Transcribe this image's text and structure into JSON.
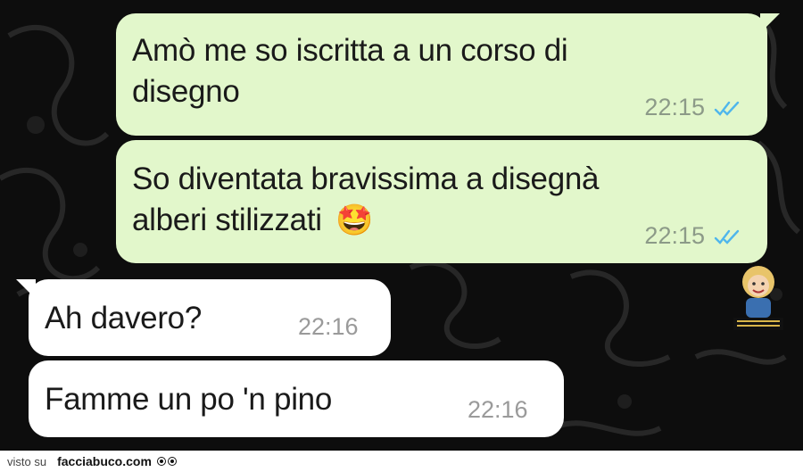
{
  "messages": [
    {
      "direction": "outgoing",
      "lines": [
        "Amò me so iscritta a un corso di",
        "disegno"
      ],
      "time": "22:15",
      "status_icon": "double-check-read-icon"
    },
    {
      "direction": "outgoing",
      "lines": [
        "So diventata bravissima a disegnà",
        "alberi stilizzati"
      ],
      "emoji": "🤩",
      "time": "22:15",
      "status_icon": "double-check-read-icon"
    },
    {
      "direction": "incoming",
      "lines": [
        "Ah davero?"
      ],
      "time": "22:16"
    },
    {
      "direction": "incoming",
      "lines": [
        "Famme un po 'n pino"
      ],
      "time": "22:16"
    }
  ],
  "colors": {
    "outgoing_bubble": "#e2f7cb",
    "incoming_bubble": "#ffffff",
    "read_ticks": "#4fb6ec",
    "wallpaper": "#0b0b0b"
  },
  "footer": {
    "visto_su": "visto su",
    "brand": "facciabuco.com"
  }
}
